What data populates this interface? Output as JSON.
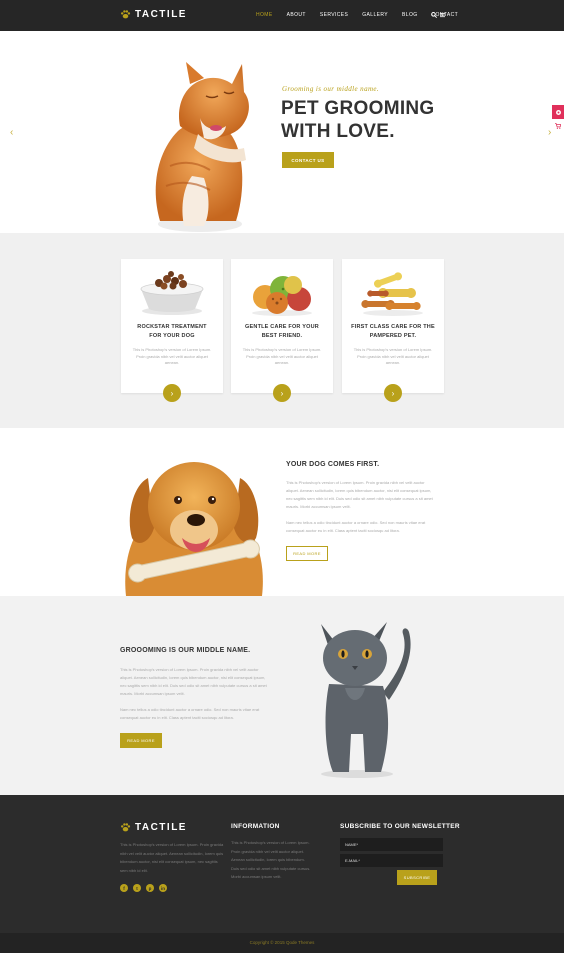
{
  "brand": {
    "name": "TACTILE"
  },
  "nav": {
    "items": [
      "HOME",
      "ABOUT",
      "SERVICES",
      "GALLERY",
      "BLOG",
      "CONTACT"
    ],
    "active": "HOME",
    "icons": [
      "search-icon",
      "menu-icon"
    ]
  },
  "hero": {
    "tagline": "Grooming is our middle name.",
    "title_line1": "PET GROOMING",
    "title_line2": "WITH LOVE.",
    "button": "CONTACT US"
  },
  "services": [
    {
      "title_line1": "ROCKSTAR TREATMENT",
      "title_line2": "FOR YOUR DOG",
      "text": "This is Photoshop's version of Lorem Ipsum. Proin gravida nibh vel velit auctor aliquet aenean."
    },
    {
      "title_line1": "GENTLE CARE FOR YOUR",
      "title_line2": "BEST FRIEND.",
      "text": "This is Photoshop's version of Lorem Ipsum. Proin gravida nibh vel velit auctor aliquet aenean."
    },
    {
      "title_line1": "FIRST CLASS CARE FOR THE",
      "title_line2": "PAMPERED PET.",
      "text": "This is Photoshop's version of Lorem Ipsum. Proin gravida nibh vel velit auctor aliquet aenean."
    }
  ],
  "dog_section": {
    "title": "YOUR DOG COMES FIRST.",
    "para1": "This is Photoshop's version of Lorem Ipsum. Proin gravida nibh vel velit auctor aliquet. Aenean sollicitudin, lorem quis bibendum auctor, nisi elit consequat ipsum, nec sagittis sem nibh id elit. Duis sed odio sit amet nibh vulputate cursus a sit amet mauris. Morbi accumsan ipsum velit.",
    "para2": "Nam nec tellus a odio tincidunt auctor a ornare odio. Sed non mauris vitae erat consequat auctor eu in elit. Class aptent taciti sociosqu ad litora.",
    "button": "READ MORE"
  },
  "cat_section": {
    "title": "GROOOMING IS OUR MIDDLE NAME.",
    "para1": "This is Photoshop's version of Lorem Ipsum. Proin gravida nibh vel velit auctor aliquet. Aenean sollicitudin, lorem quis bibendum auctor, nisi elit consequat ipsum, nec sagittis sem nibh id elit. Duis sed odio sit amet nibh vulputate cursus a sit amet mauris. Morbi accumsan ipsum velit.",
    "para2": "Nam nec tellus a odio tincidunt auctor a ornare odio. Sed non mauris vitae erat consequat auctor eu in elit. Class aptent taciti sociosqu ad litora.",
    "button": "READ MORE"
  },
  "footer": {
    "about": "This is Photoshop's version of Lorem Ipsum. Proin gravida nibh vel velit auctor aliquet. Aenean sollicitudin, lorem quis bibendum auctor, nisi elit consequat ipsum, nec sagittis sem nibh id elit.",
    "info_title": "INFORMATION",
    "info_items": [
      "This is Photoshop's version of Lorem Ipsum.",
      "Proin gravida nibh vel velit auctor aliquet.",
      "Aenean sollicitudin, lorem quis bibendum.",
      "Duis sed odio sit amet nibh vulputate cursus.",
      "Morbi accumsan ipsum velit."
    ],
    "newsletter_title": "SUBSCRIBE TO OUR NEWSLETTER",
    "name_placeholder": "NAME*",
    "email_placeholder": "E-MAIL*",
    "subscribe": "SUBSCRIBE",
    "social_icons": [
      "facebook-icon",
      "twitter-icon",
      "pinterest-icon",
      "linkedin-icon"
    ],
    "social_glyphs": [
      "f",
      "t",
      "p",
      "in"
    ],
    "copyright": "Copyright © 2015 Qode Themes"
  },
  "colors": {
    "accent": "#b9a11b",
    "dark": "#262626",
    "pink": "#e0305b"
  }
}
